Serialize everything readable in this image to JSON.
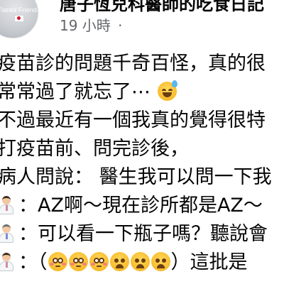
{
  "post": {
    "author": "唐子恆兒科醫師的吃食日記",
    "avatar_text": "Tianke Friends",
    "timestamp": "19 小時",
    "visibility_dot": "·",
    "lines": [
      "疫苗診的問題千奇百怪，真的很",
      "常常過了就忘了⋯",
      "不過最近有一個我真的覺得很特",
      "打疫苗前、問完診後，",
      "病人問說： 醫生我可以問一下我",
      "：AZ啊～現在診所都是AZ～",
      "：可以看一下瓶子嗎？聽說會",
      "：（",
      "）這批是"
    ]
  },
  "icons": {
    "avatar": "doctor-avatar",
    "sweat_emoji": "grinning-sweat-emoji",
    "flushed_emoji": "flushed-face-emoji",
    "worried_emoji": "frowning-face-emoji",
    "doctor_emoji": "health-worker-emoji"
  },
  "colors": {
    "text": "#050505",
    "secondary_text": "#65676b",
    "background": "#ffffff"
  }
}
